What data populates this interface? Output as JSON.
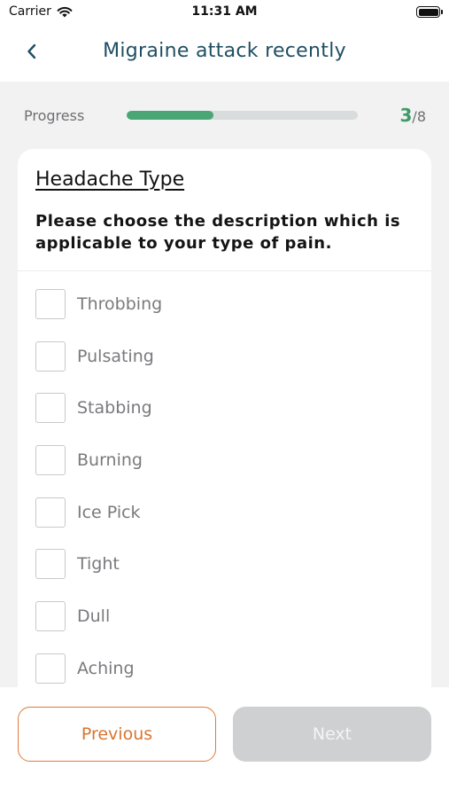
{
  "status_bar": {
    "carrier": "Carrier",
    "time": "11:31 AM"
  },
  "nav": {
    "title": "Migraine attack recently",
    "back_icon": "chevron-left-icon"
  },
  "progress": {
    "label": "Progress",
    "current": "3",
    "total": "/8",
    "fraction": 0.375,
    "color": "#4aa775"
  },
  "card": {
    "title": "Headache Type",
    "question": "Please choose the description which is applicable to your type of pain.",
    "options": [
      "Throbbing",
      "Pulsating",
      "Stabbing",
      "Burning",
      "Ice Pick",
      "Tight",
      "Dull",
      "Aching"
    ]
  },
  "footer": {
    "previous_label": "Previous",
    "next_label": "Next",
    "accent": "#e07a3a"
  }
}
